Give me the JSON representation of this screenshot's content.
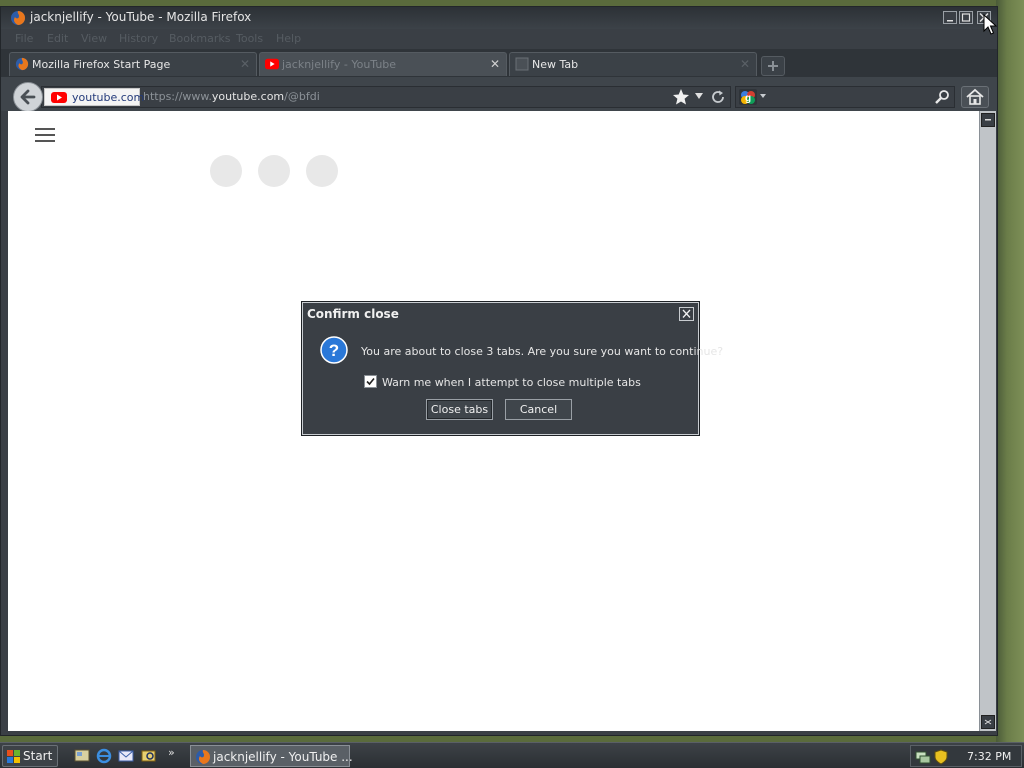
{
  "window": {
    "title": "jacknjellify - YouTube - Mozilla Firefox"
  },
  "menubar": {
    "items": [
      "File",
      "Edit",
      "View",
      "History",
      "Bookmarks",
      "Tools",
      "Help"
    ]
  },
  "tabs": [
    {
      "label": "Mozilla Firefox Start Page",
      "icon": "firefox-icon",
      "active": false
    },
    {
      "label": "jacknjellify - YouTube",
      "icon": "youtube-icon",
      "active": true
    },
    {
      "label": "New Tab",
      "icon": "blank-page-icon",
      "active": false
    }
  ],
  "navbar": {
    "site_identity": "youtube.com",
    "url_prefix": "https://www.",
    "url_domain": "youtube.com",
    "url_path": "/@bfdi"
  },
  "dialog": {
    "title": "Confirm close",
    "message": "You are about to close 3 tabs. Are you sure you want to continue?",
    "checkbox_label": "Warn me when I attempt to close multiple tabs",
    "checkbox_checked": true,
    "primary_button": "Close tabs",
    "cancel_button": "Cancel"
  },
  "taskbar": {
    "start_label": "Start",
    "more_label": "»",
    "task_label": "jacknjellify - YouTube ...",
    "clock": "7:32 PM"
  },
  "colors": {
    "chrome": "#3a3f45",
    "content": "#ffffff",
    "youtube_red": "#ff0000"
  }
}
